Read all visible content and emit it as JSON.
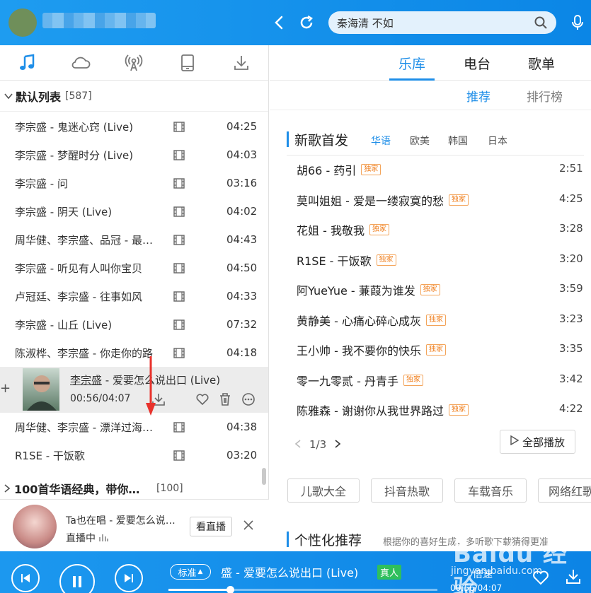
{
  "search": {
    "query": "秦海清 不如"
  },
  "left": {
    "tabs": [
      "music-note-icon",
      "cloud-icon",
      "radio-icon",
      "device-icon",
      "download-icon"
    ],
    "list_title": "默认列表",
    "list_count": "[587]",
    "songs": [
      {
        "title": "李宗盛 - 鬼迷心窍 (Live)",
        "dur": "04:25"
      },
      {
        "title": "李宗盛 - 梦醒时分 (Live)",
        "dur": "04:03"
      },
      {
        "title": "李宗盛 - 问",
        "dur": "03:16"
      },
      {
        "title": "李宗盛 - 阴天 (Live)",
        "dur": "04:02"
      },
      {
        "title": "周华健、李宗盛、品冠 - 最…",
        "dur": "04:43"
      },
      {
        "title": "李宗盛 - 听见有人叫你宝贝",
        "dur": "04:50"
      },
      {
        "title": "卢冠廷、李宗盛 - 往事如风",
        "dur": "04:33"
      },
      {
        "title": "李宗盛 - 山丘 (Live)",
        "dur": "07:32"
      },
      {
        "title": "陈淑桦、李宗盛 - 你走你的路",
        "dur": "04:18"
      }
    ],
    "playing": {
      "artist": "李宗盛",
      "title": " - 爱要怎么说出口 (Live)",
      "time": "00:56/04:07"
    },
    "songs_after": [
      {
        "title": "周华健、李宗盛 - 漂洋过海…",
        "dur": "04:38"
      },
      {
        "title": "R1SE - 干饭歌",
        "dur": "03:20"
      }
    ],
    "group2_title": "100首华语经典，带你…",
    "group2_count": "[100]",
    "live": {
      "title": "Ta也在唱 - 爱要怎么说…",
      "status": "直播中",
      "button": "看直播"
    }
  },
  "right": {
    "tabs": [
      "乐库",
      "电台",
      "歌单"
    ],
    "subtabs": [
      "推荐",
      "排行榜"
    ],
    "section_title": "新歌首发",
    "filters": [
      "华语",
      "欧美",
      "韩国",
      "日本"
    ],
    "tag_label": "独家",
    "songs": [
      {
        "title": "胡66 - 药引",
        "dur": "2:51"
      },
      {
        "title": "莫叫姐姐 - 爱是一缕寂寞的愁",
        "dur": "4:25"
      },
      {
        "title": "花姐 - 我敬我",
        "dur": "3:28"
      },
      {
        "title": "R1SE - 干饭歌",
        "dur": "3:20"
      },
      {
        "title": "阿YueYue - 蒹葭为谁发",
        "dur": "3:59"
      },
      {
        "title": "黄静美 - 心痛心碎心成灰",
        "dur": "3:23"
      },
      {
        "title": "王小帅 - 我不要你的快乐",
        "dur": "3:35"
      },
      {
        "title": "零一九零贰 - 丹青手",
        "dur": "3:42"
      },
      {
        "title": "陈雅森 - 谢谢你从我世界路过",
        "dur": "4:22"
      }
    ],
    "page": "1/3",
    "play_all": "全部播放",
    "chips": [
      "儿歌大全",
      "抖音热歌",
      "车载音乐",
      "网络红歌"
    ],
    "section2_title": "个性化推荐",
    "section2_desc": "根据你的喜好生成，多听歌下载猜得更准"
  },
  "player": {
    "quality": "标准",
    "now_title": "盛 - 爱要怎么说出口 (Live)",
    "badge": "真人",
    "speed": "倍速",
    "time": "00:56/04:07",
    "progress": 0.23
  },
  "watermark": {
    "brand": "Baidu 经验",
    "url": "jingyan.baidu.com"
  }
}
